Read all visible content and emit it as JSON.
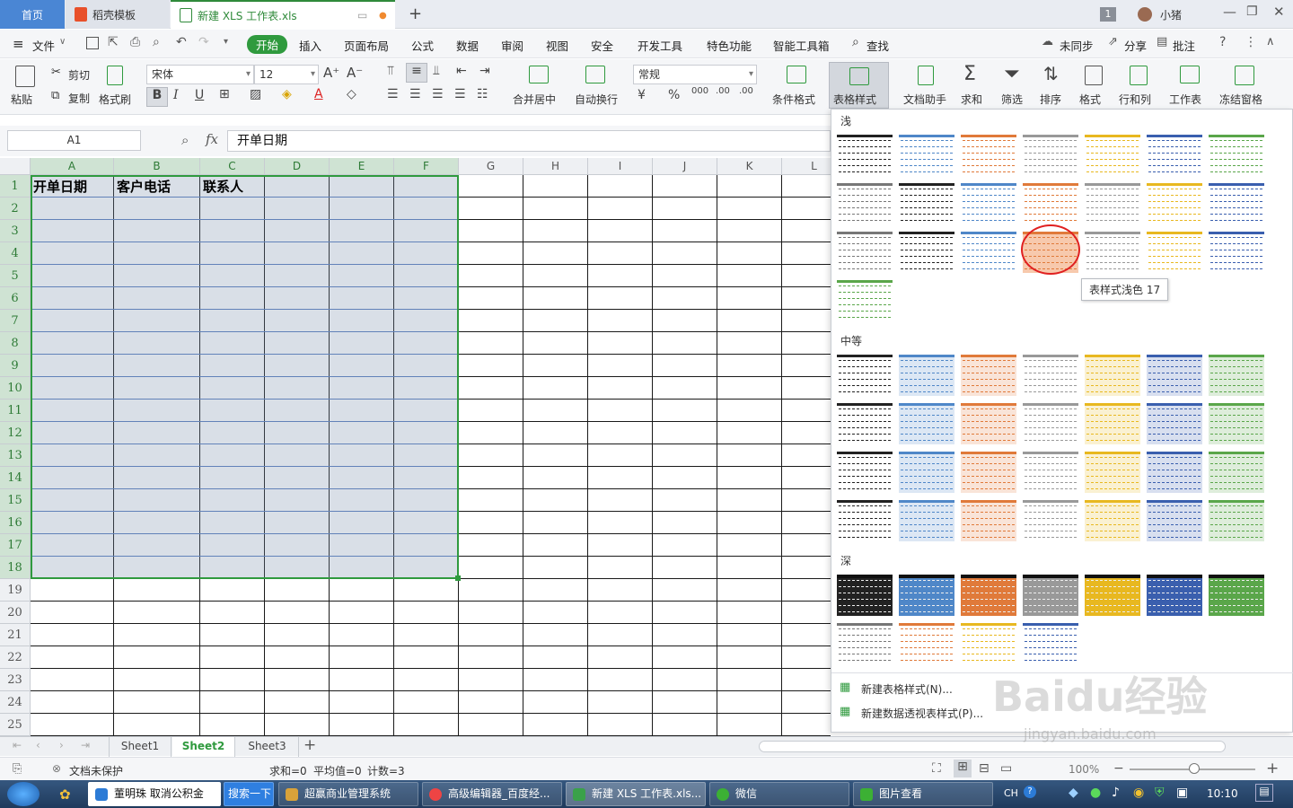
{
  "titlebar": {
    "tabs": [
      {
        "label": "首页"
      },
      {
        "label": "稻壳模板"
      },
      {
        "label": "新建 XLS 工作表.xls"
      }
    ],
    "badge": "1",
    "user": "小猪"
  },
  "menubar": {
    "file": "文件",
    "items": [
      "开始",
      "插入",
      "页面布局",
      "公式",
      "数据",
      "审阅",
      "视图",
      "安全",
      "开发工具",
      "特色功能",
      "智能工具箱"
    ],
    "search": "查找",
    "sync": "未同步",
    "share": "分享",
    "comment": "批注"
  },
  "ribbon": {
    "paste": "粘贴",
    "cut": "剪切",
    "copy": "复制",
    "format_painter": "格式刷",
    "font": "宋体",
    "font_size": "12",
    "merge": "合并居中",
    "wrap": "自动换行",
    "number_format": "常规",
    "conditional": "条件格式",
    "table_style": "表格样式",
    "doc_helper": "文档助手",
    "sum": "求和",
    "filter": "筛选",
    "sort": "排序",
    "format": "格式",
    "rowcol": "行和列",
    "sheet": "工作表",
    "freeze": "冻结窗格"
  },
  "formulabar": {
    "namebox": "A1",
    "fx": "fx",
    "content": "开单日期"
  },
  "grid": {
    "columns": [
      "A",
      "B",
      "C",
      "D",
      "E",
      "F",
      "G",
      "H",
      "I",
      "J",
      "K",
      "L"
    ],
    "rows": [
      "1",
      "2",
      "3",
      "4",
      "5",
      "6",
      "7",
      "8",
      "9",
      "10",
      "11",
      "12",
      "13",
      "14",
      "15",
      "16",
      "17",
      "18",
      "19",
      "20",
      "21",
      "22",
      "23",
      "24",
      "25"
    ],
    "headers": [
      "开单日期",
      "客户电话",
      "联系人"
    ]
  },
  "gallery": {
    "sections": [
      "浅",
      "中等",
      "深"
    ],
    "tooltip": "表样式浅色 17",
    "new_table_style": "新建表格样式(N)...",
    "new_pivot_style": "新建数据透视表样式(P)..."
  },
  "sheets": [
    "Sheet1",
    "Sheet2",
    "Sheet3"
  ],
  "statusbar": {
    "protection": "文档未保护",
    "sum": "求和=0",
    "avg": "平均值=0",
    "count": "计数=3",
    "zoom": "100%"
  },
  "taskbar": {
    "items": [
      "董明珠 取消公积金",
      "搜索一下",
      "超赢商业管理系统",
      "高级编辑器_百度经...",
      "新建 XLS 工作表.xls...",
      "微信",
      "图片查看"
    ],
    "lang": "CH",
    "time": "10:10"
  },
  "watermark": "Baidu经验",
  "watermark_url": "jingyan.baidu.com",
  "colors": {
    "accent_green": "#2f9a3e",
    "tab_blue": "#4a86d4",
    "highlight_red": "#e02020"
  }
}
